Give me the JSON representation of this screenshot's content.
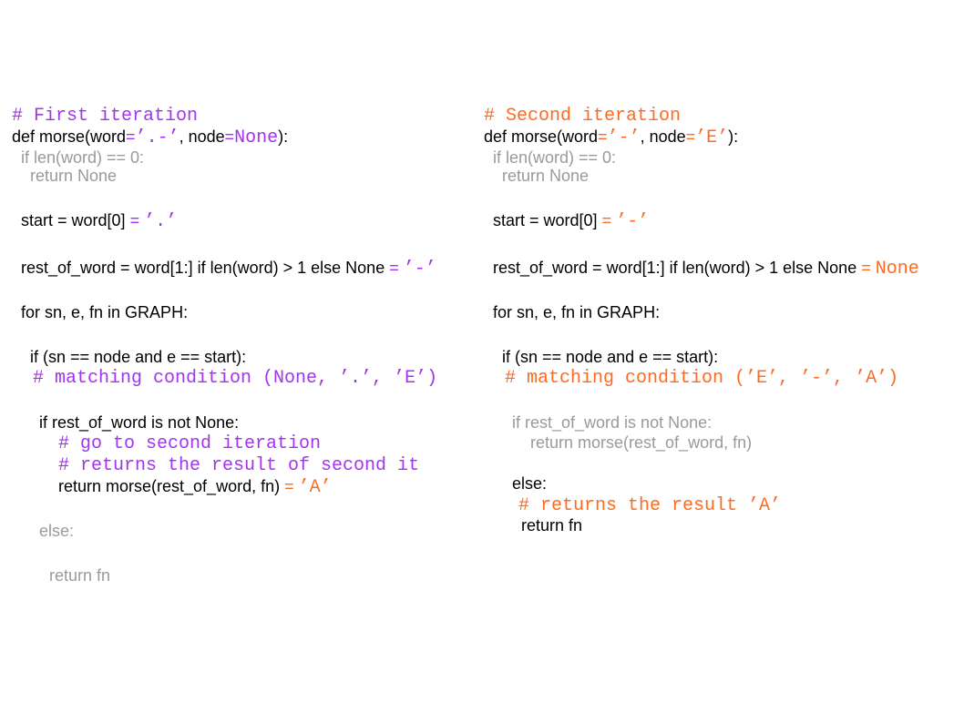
{
  "colors": {
    "text": "#000000",
    "muted": "#9a9a9a",
    "purple": "#a233f0",
    "orange": "#ff6a1f"
  },
  "panels": [
    {
      "name": "first-iteration",
      "lines": [
        {
          "segments": [
            {
              "text": "# First iteration",
              "color": "purple",
              "mono": true
            }
          ]
        },
        {
          "segments": [
            {
              "text": "def morse(word",
              "color": "text"
            },
            {
              "text": "=",
              "color": "purple"
            },
            {
              "text": "’.-’",
              "color": "purple",
              "mono": true
            },
            {
              "text": ", node",
              "color": "text"
            },
            {
              "text": "=",
              "color": "purple"
            },
            {
              "text": "None",
              "color": "purple",
              "mono": true
            },
            {
              "text": "):",
              "color": "text"
            }
          ]
        },
        {
          "segments": [
            {
              "text": "if len(word) == 0:",
              "color": "muted"
            }
          ]
        },
        {
          "segments": [
            {
              "text": "return None",
              "color": "muted"
            }
          ]
        },
        {
          "segments": [
            {
              "text": "start = word[0] ",
              "color": "text"
            },
            {
              "text": "= ",
              "color": "purple"
            },
            {
              "text": "’.’",
              "color": "purple",
              "mono": true
            }
          ]
        },
        {
          "segments": [
            {
              "text": "rest_of_word = word[1:] if len(word) > 1 else None ",
              "color": "text"
            },
            {
              "text": "= ",
              "color": "purple"
            },
            {
              "text": "’-’",
              "color": "purple",
              "mono": true
            }
          ]
        },
        {
          "segments": [
            {
              "text": "for sn, e, fn in GRAPH:",
              "color": "text"
            }
          ]
        },
        {
          "segments": [
            {
              "text": "if (sn == node and e == start):",
              "color": "text"
            }
          ]
        },
        {
          "segments": [
            {
              "text": "# matching condition (None, ’.’, ’E’)",
              "color": "purple",
              "mono": true
            }
          ]
        },
        {
          "segments": [
            {
              "text": "if rest_of_word is not None:",
              "color": "text"
            }
          ]
        },
        {
          "segments": [
            {
              "text": "# go to second iteration",
              "color": "purple",
              "mono": true
            }
          ]
        },
        {
          "segments": [
            {
              "text": "# returns the result of second it",
              "color": "purple",
              "mono": true
            }
          ]
        },
        {
          "segments": [
            {
              "text": "return morse(rest_of_word, fn) ",
              "color": "text"
            },
            {
              "text": "= ",
              "color": "orange"
            },
            {
              "text": "’A’",
              "color": "orange",
              "mono": true
            }
          ]
        },
        {
          "segments": [
            {
              "text": "else:",
              "color": "muted"
            }
          ]
        },
        {
          "segments": [
            {
              "text": "return fn",
              "color": "muted"
            }
          ]
        }
      ]
    },
    {
      "name": "second-iteration",
      "lines": [
        {
          "segments": [
            {
              "text": "# Second iteration",
              "color": "orange",
              "mono": true
            }
          ]
        },
        {
          "segments": [
            {
              "text": "def morse(word",
              "color": "text"
            },
            {
              "text": "=",
              "color": "orange"
            },
            {
              "text": "’-’",
              "color": "orange",
              "mono": true
            },
            {
              "text": ", node",
              "color": "text"
            },
            {
              "text": "=",
              "color": "orange"
            },
            {
              "text": "’E’",
              "color": "orange",
              "mono": true
            },
            {
              "text": "):",
              "color": "text"
            }
          ]
        },
        {
          "segments": [
            {
              "text": "if len(word) == 0:",
              "color": "muted"
            }
          ]
        },
        {
          "segments": [
            {
              "text": "return None",
              "color": "muted"
            }
          ]
        },
        {
          "segments": [
            {
              "text": "start = word[0] ",
              "color": "text"
            },
            {
              "text": "= ",
              "color": "orange"
            },
            {
              "text": "’-’",
              "color": "orange",
              "mono": true
            }
          ]
        },
        {
          "segments": [
            {
              "text": "rest_of_word = word[1:] if len(word) > 1 else None ",
              "color": "text"
            },
            {
              "text": "= ",
              "color": "orange"
            },
            {
              "text": "None",
              "color": "orange",
              "mono": true
            }
          ]
        },
        {
          "segments": [
            {
              "text": "for sn, e, fn in GRAPH:",
              "color": "text"
            }
          ]
        },
        {
          "segments": [
            {
              "text": "if (sn == node and e == start):",
              "color": "text"
            }
          ]
        },
        {
          "segments": [
            {
              "text": "# matching condition (’E’, ’-’, ’A’)",
              "color": "orange",
              "mono": true
            }
          ]
        },
        {
          "segments": [
            {
              "text": "if rest_of_word is not None:",
              "color": "muted"
            }
          ]
        },
        {
          "segments": [
            {
              "text": "return morse(rest_of_word, fn)",
              "color": "muted"
            }
          ]
        },
        {
          "segments": [
            {
              "text": "else:",
              "color": "text"
            }
          ]
        },
        {
          "segments": [
            {
              "text": "# returns the result ’A’",
              "color": "orange",
              "mono": true
            }
          ]
        },
        {
          "segments": [
            {
              "text": "return fn",
              "color": "text"
            }
          ]
        }
      ]
    }
  ]
}
